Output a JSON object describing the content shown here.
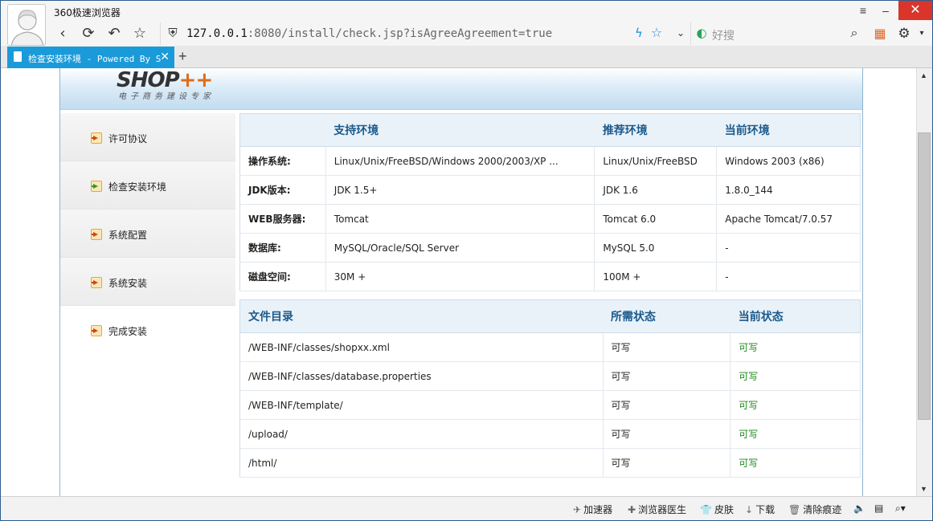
{
  "browser": {
    "title": "360极速浏览器",
    "address": {
      "host": "127.0.0.1",
      "rest": ":8080/install/check.jsp?isAgreeAgreement=true"
    },
    "search_placeholder": "好搜",
    "tab_label": "检查安装环境 - Powered By S"
  },
  "page": {
    "logo": {
      "text": "SHOP",
      "plus": "++",
      "sub": "电子商务建设专家"
    },
    "sidebar": [
      {
        "label": "许可协议"
      },
      {
        "label": "检查安装环境"
      },
      {
        "label": "系统配置"
      },
      {
        "label": "系统安装"
      },
      {
        "label": "完成安装"
      }
    ],
    "env_table": {
      "headers": [
        "",
        "支持环境",
        "推荐环境",
        "当前环境"
      ],
      "rows": [
        [
          "操作系统:",
          "Linux/Unix/FreeBSD/Windows 2000/2003/XP ...",
          "Linux/Unix/FreeBSD",
          "Windows 2003 (x86)"
        ],
        [
          "JDK版本:",
          "JDK 1.5+",
          "JDK 1.6",
          "1.8.0_144"
        ],
        [
          "WEB服务器:",
          "Tomcat",
          "Tomcat 6.0",
          "Apache Tomcat/7.0.57"
        ],
        [
          "数据库:",
          "MySQL/Oracle/SQL Server",
          "MySQL 5.0",
          "-"
        ],
        [
          "磁盘空间:",
          "30M +",
          "100M +",
          "-"
        ]
      ]
    },
    "files_table": {
      "headers": [
        "文件目录",
        "所需状态",
        "当前状态"
      ],
      "rows": [
        [
          "/WEB-INF/classes/shopxx.xml",
          "可写",
          "可写"
        ],
        [
          "/WEB-INF/classes/database.properties",
          "可写",
          "可写"
        ],
        [
          "/WEB-INF/template/",
          "可写",
          "可写"
        ],
        [
          "/upload/",
          "可写",
          "可写"
        ],
        [
          "/html/",
          "可写",
          "可写"
        ]
      ]
    }
  },
  "statusbar": {
    "accelerator": "加速器",
    "doctor": "浏览器医生",
    "skin": "皮肤",
    "download": "下载",
    "clear": "清除痕迹"
  },
  "colors": {
    "tab_active": "#1b9ad9",
    "ok_text": "#1e8a1e",
    "header_text": "#1a5a8c",
    "close_button": "#d9352b"
  }
}
